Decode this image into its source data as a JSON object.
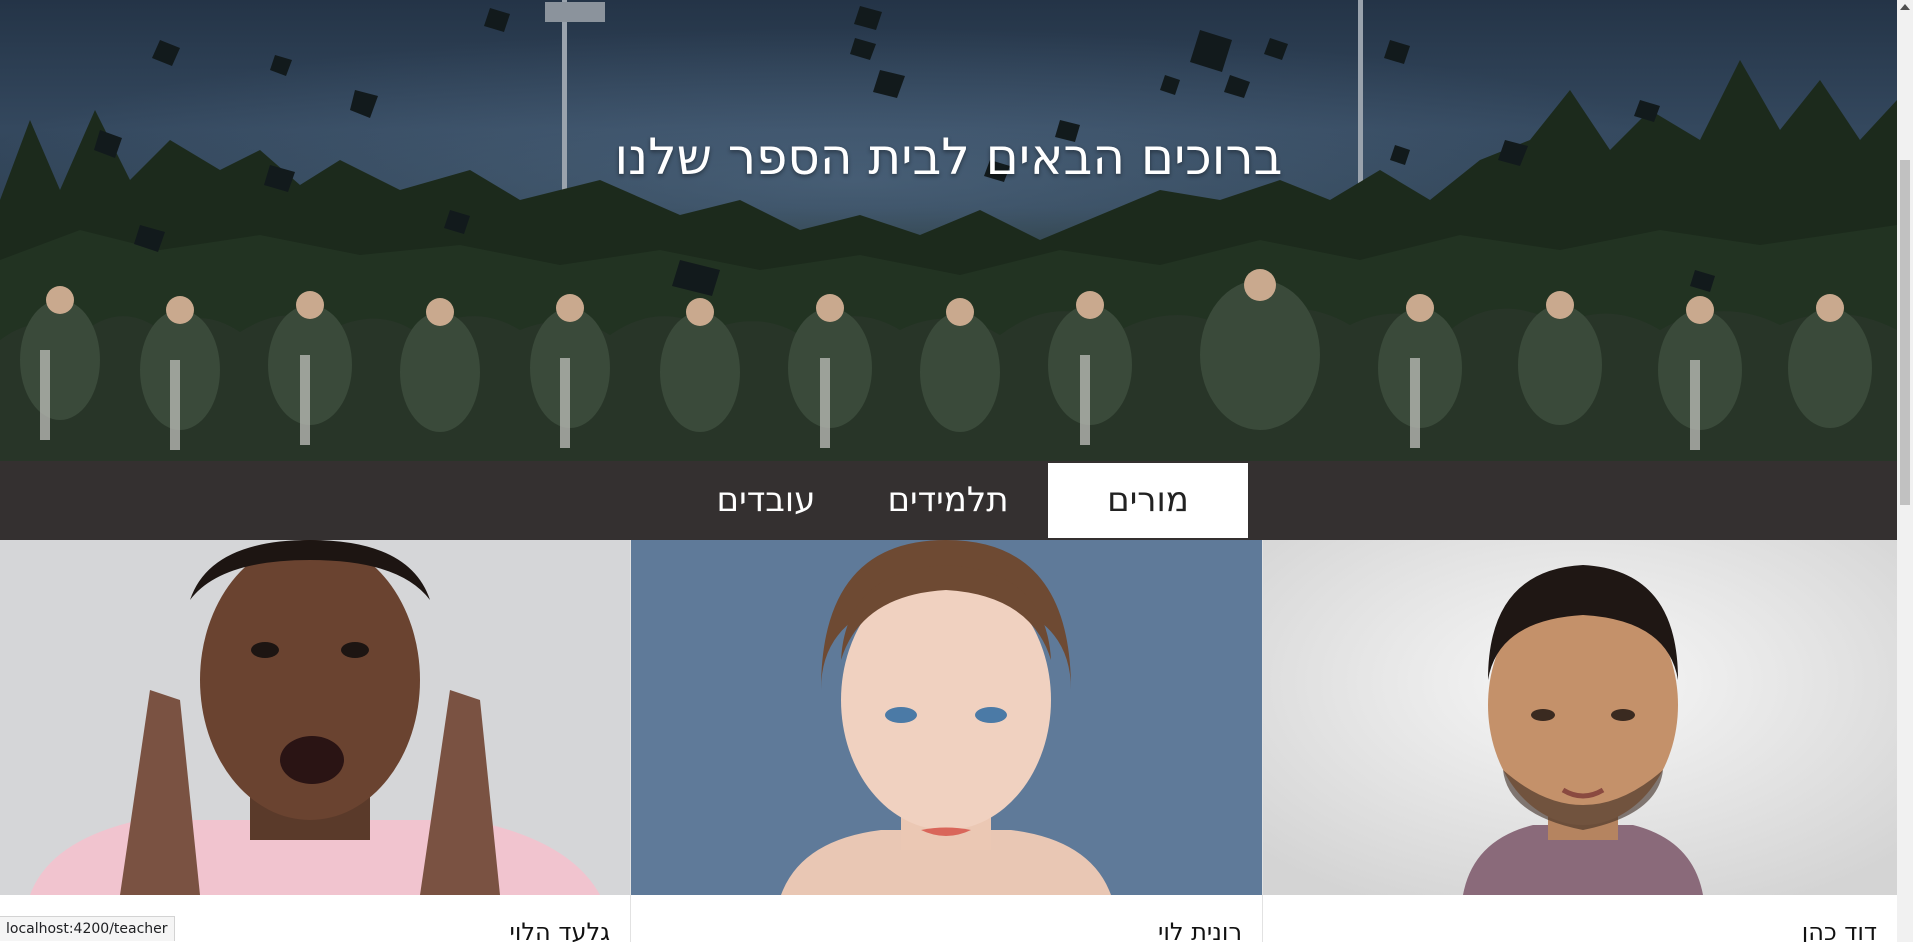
{
  "hero": {
    "title": "ברוכים הבאים לבית הספר שלנו",
    "image": "graduation-caps-thrown-photo"
  },
  "tabs": [
    {
      "label": "מורים",
      "active": true
    },
    {
      "label": "תלמידים",
      "active": false
    },
    {
      "label": "עובדים",
      "active": false
    }
  ],
  "cards": [
    {
      "name": "דוד כהן",
      "image": "man-portrait-photo"
    },
    {
      "name": "רונית לוי",
      "image": "woman-portrait-photo"
    },
    {
      "name": "גלעד הלוי",
      "image": "man-touching-face-photo"
    }
  ],
  "status_bar": {
    "url": "localhost:4200/teacher"
  },
  "colors": {
    "tabbar_bg": "#343030",
    "active_tab_bg": "#ffffff",
    "hero_text": "#ffffff"
  }
}
